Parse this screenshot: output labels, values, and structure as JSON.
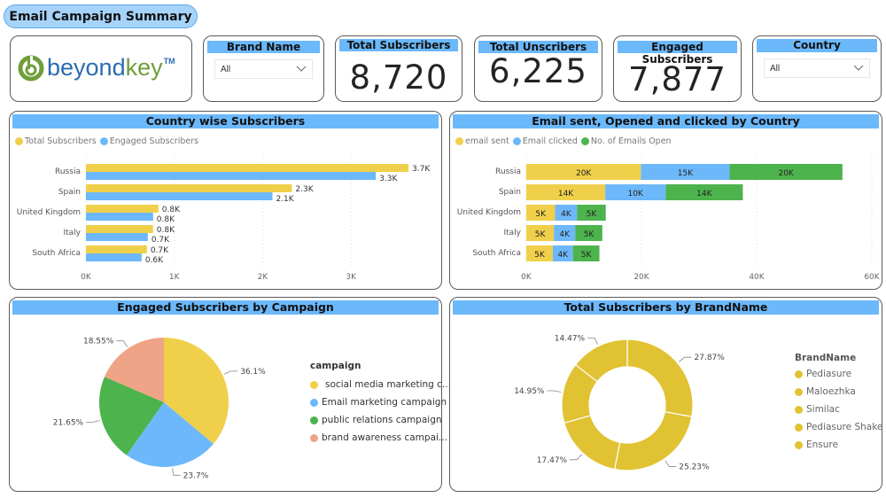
{
  "page": {
    "title": "Email Campaign Summary"
  },
  "logo": {
    "text_main": "beyond",
    "text_accent": "key",
    "trademark": "TM"
  },
  "slicers": {
    "brand": {
      "label": "Brand Name",
      "value": "All"
    },
    "country": {
      "label": "Country",
      "value": "All"
    }
  },
  "kpis": {
    "total_subscribers": {
      "label": "Total Subscribers",
      "value": "8,720"
    },
    "total_unsubscribers": {
      "label": "Total Unscribers",
      "value": "6,225"
    },
    "engaged_subscribers": {
      "label": "Engaged Subscribers",
      "value": "7,877"
    }
  },
  "colors": {
    "header_blue": "#6bb8fb",
    "yellow": "#f0d04a",
    "blue": "#6db8fb",
    "green": "#4db34d",
    "salmon": "#f0a487",
    "donut_gold": "#e1c232"
  },
  "chart_data": [
    {
      "id": "country_subscribers",
      "type": "bar",
      "orientation": "horizontal",
      "title": "Country wise Subscribers",
      "categories": [
        "Russia",
        "Spain",
        "United Kingdom",
        "Italy",
        "South Africa"
      ],
      "series": [
        {
          "name": "Total Subscribers",
          "color": "#f0d04a",
          "values": [
            3650,
            2330,
            820,
            760,
            690
          ],
          "labels": [
            "3.7K",
            "2.3K",
            "0.8K",
            "0.8K",
            "0.7K"
          ]
        },
        {
          "name": "Engaged Subscribers",
          "color": "#6db8fb",
          "values": [
            3280,
            2110,
            760,
            700,
            630
          ],
          "labels": [
            "3.3K",
            "2.1K",
            "0.8K",
            "0.7K",
            "0.6K"
          ]
        }
      ],
      "xlim": [
        0,
        3900
      ],
      "xticks": [
        "0K",
        "1K",
        "2K",
        "3K"
      ],
      "xtick_values": [
        0,
        1000,
        2000,
        3000
      ],
      "legend": "top-left",
      "grid": true
    },
    {
      "id": "email_by_country",
      "type": "bar",
      "orientation": "horizontal",
      "stacked": true,
      "title": "Email sent, Opened and clicked by Country",
      "categories": [
        "Russia",
        "Spain",
        "United Kingdom",
        "Italy",
        "South Africa"
      ],
      "series": [
        {
          "name": "email sent",
          "color": "#f0d04a",
          "values": [
            19900,
            13700,
            5000,
            4800,
            4600
          ],
          "labels": [
            "20K",
            "14K",
            "5K",
            "5K",
            "5K"
          ]
        },
        {
          "name": "Email clicked",
          "color": "#6db8fb",
          "values": [
            15400,
            10500,
            3800,
            3700,
            3500
          ],
          "labels": [
            "15K",
            "10K",
            "4K",
            "4K",
            "4K"
          ]
        },
        {
          "name": "No. of Emails Open",
          "color": "#4db34d",
          "values": [
            19600,
            13400,
            5000,
            4700,
            4600
          ],
          "labels": [
            "20K",
            "14K",
            "5K",
            "5K",
            "5K"
          ]
        }
      ],
      "xlim": [
        0,
        60000
      ],
      "xticks": [
        "0K",
        "20K",
        "40K",
        "60K"
      ],
      "xtick_values": [
        0,
        20000,
        40000,
        60000
      ],
      "legend": "top-left",
      "grid": true
    },
    {
      "id": "engaged_by_campaign",
      "type": "pie",
      "title": "Engaged Subscribers by Campaign",
      "legend_title": "campaign",
      "slices": [
        {
          "name": "social media marketing c...",
          "value": 36.1,
          "label": "36.1%",
          "color": "#f0d04a"
        },
        {
          "name": "Email marketing campaign",
          "value": 23.7,
          "label": "23.7%",
          "color": "#6db8fb"
        },
        {
          "name": "public relations campaign",
          "value": 21.65,
          "label": "21.65%",
          "color": "#4db34d"
        },
        {
          "name": "brand awareness campai...",
          "value": 18.55,
          "label": "18.55%",
          "color": "#f0a487"
        }
      ],
      "legend": "right"
    },
    {
      "id": "subscribers_by_brand",
      "type": "pie",
      "donut": true,
      "title": "Total Subscribers by BrandName",
      "legend_title": "BrandName",
      "slices": [
        {
          "name": "Pediasure",
          "value": 27.87,
          "label": "27.87%",
          "color": "#e1c232"
        },
        {
          "name": "Maloezhka",
          "value": 25.23,
          "label": "25.23%",
          "color": "#e1c232"
        },
        {
          "name": "Similac",
          "value": 17.47,
          "label": "17.47%",
          "color": "#e1c232"
        },
        {
          "name": "Pediasure Shake",
          "value": 14.95,
          "label": "14.95%",
          "color": "#e1c232"
        },
        {
          "name": "Ensure",
          "value": 14.47,
          "label": "14.47%",
          "color": "#e1c232"
        }
      ],
      "legend": "right"
    }
  ]
}
